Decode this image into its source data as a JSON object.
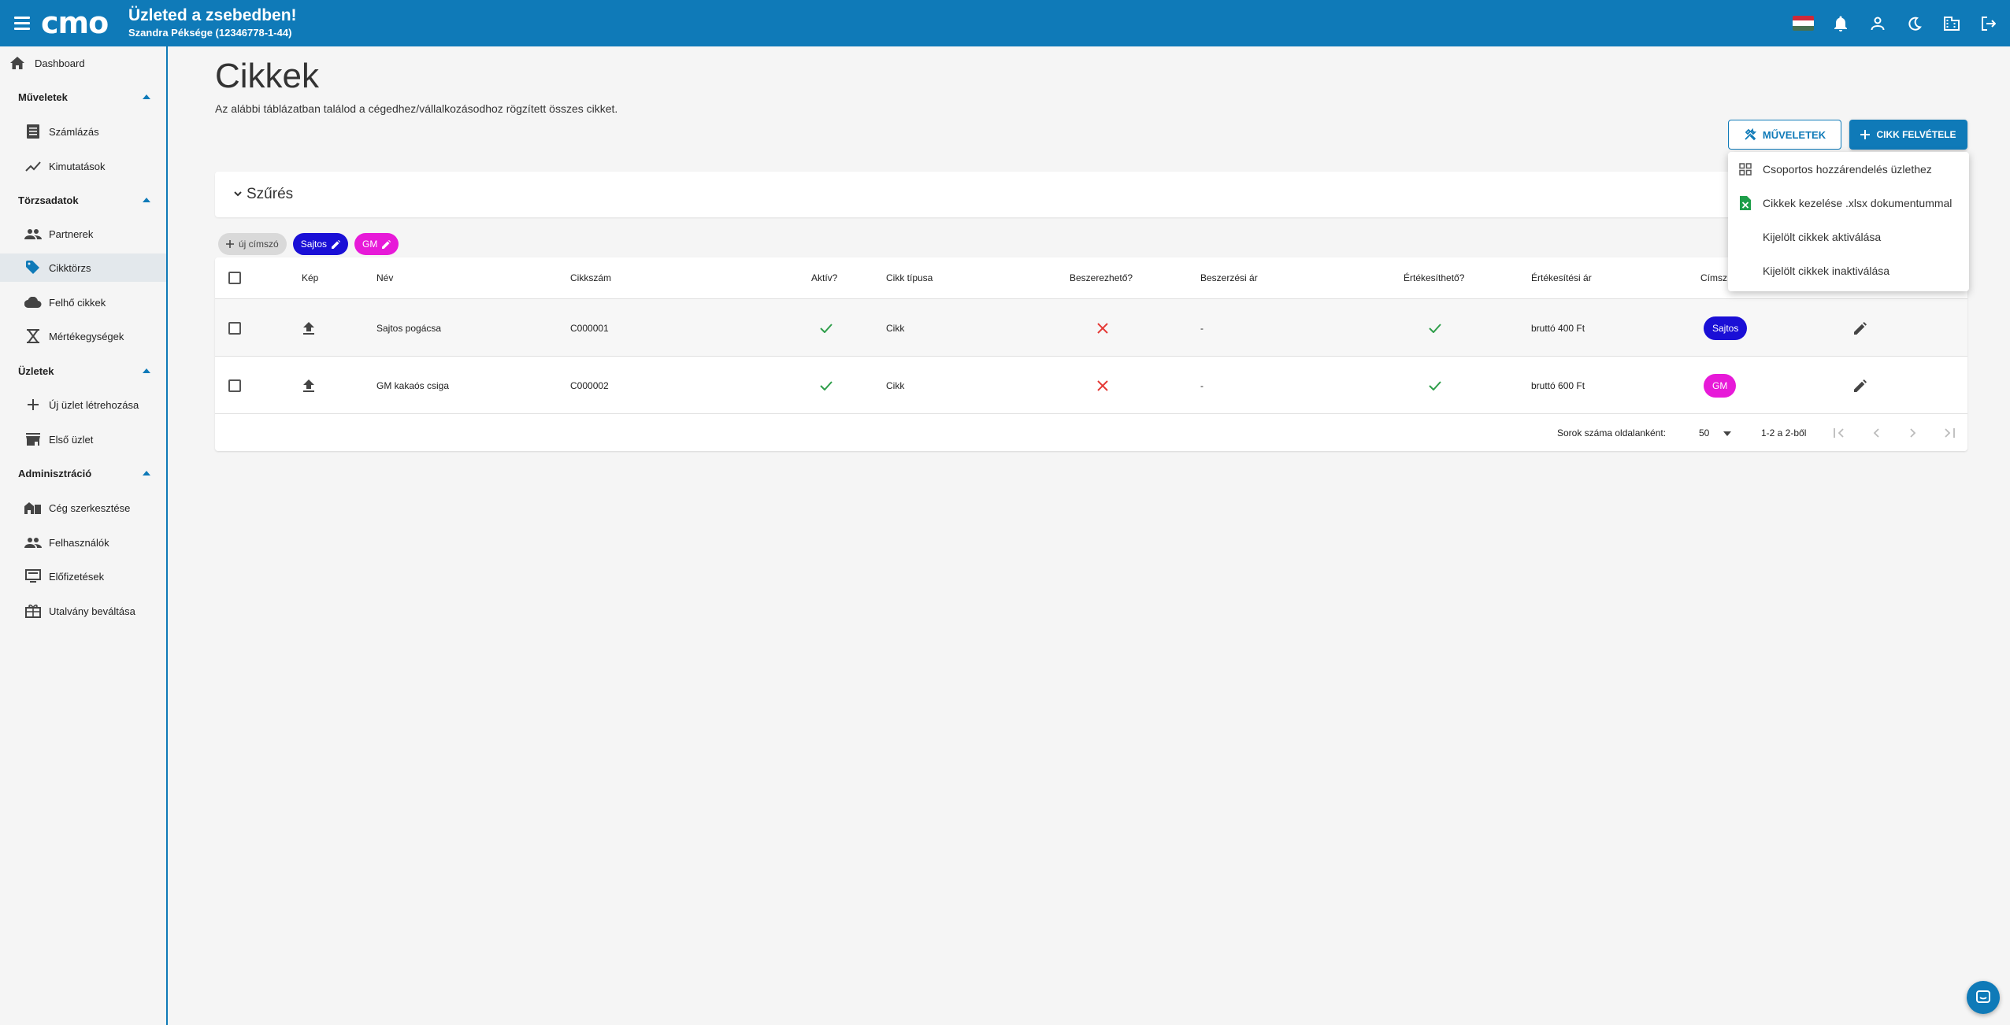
{
  "header": {
    "logo": "cmo",
    "title": "Üzleted a zsebedben!",
    "company": "Szandra Péksége (12346778-1-44)"
  },
  "sidebar": {
    "dashboard": "Dashboard",
    "sections": {
      "muveletek": "Műveletek",
      "torzsadatok": "Törzsadatok",
      "uzletek": "Üzletek",
      "adminisztracio": "Adminisztráció"
    },
    "items": {
      "szamlazas": "Számlázás",
      "kimutatasok": "Kimutatások",
      "partnerek": "Partnerek",
      "cikktorzs": "Cikktörzs",
      "felho_cikkek": "Felhő cikkek",
      "mertekegysegek": "Mértékegységek",
      "uj_uzlet": "Új üzlet létrehozása",
      "elso_uzlet": "Első üzlet",
      "ceg_szerkesztese": "Cég szerkesztése",
      "felhasznalok": "Felhasználók",
      "elofizetesek": "Előfizetések",
      "utalvany": "Utalvány beváltása"
    }
  },
  "main": {
    "title": "Cikkek",
    "description": "Az alábbi táblázatban találod a cégedhez/vállalkozásodhoz rögzített összes cikket.",
    "ops_button": "MŰVELETEK",
    "add_button": "CIKK FELVÉTELE",
    "filter_label": "Szűrés"
  },
  "chips": {
    "new": "új címszó",
    "tags": [
      {
        "label": "Sajtos",
        "color": "#1a0fd6"
      },
      {
        "label": "GM",
        "color": "#e71ad8"
      }
    ]
  },
  "table": {
    "headers": {
      "kep": "Kép",
      "nev": "Név",
      "cikkszam": "Cikkszám",
      "aktiv": "Aktív?",
      "tipus": "Cikk típusa",
      "beszerezheto": "Beszerezhető?",
      "beszerzesi_ar": "Beszerzési ár",
      "ertekesitheto": "Értékesíthető?",
      "ertekesitesi_ar": "Értékesítési ár",
      "cimszo": "Címsz"
    },
    "rows": [
      {
        "nev": "Sajtos pogácsa",
        "cikkszam": "C000001",
        "tipus": "Cikk",
        "beszerzesi_ar": "-",
        "ertekesitesi_ar": "bruttó 400 Ft",
        "tag": "Sajtos",
        "tag_color": "#1a0fd6"
      },
      {
        "nev": "GM kakaós csiga",
        "cikkszam": "C000002",
        "tipus": "Cikk",
        "beszerzesi_ar": "-",
        "ertekesitesi_ar": "bruttó 600 Ft",
        "tag": "GM",
        "tag_color": "#e71ad8"
      }
    ],
    "footer": {
      "rows_per_page_label": "Sorok száma oldalanként:",
      "rows_per_page": "50",
      "range": "1-2 a 2-ből"
    }
  },
  "dropdown": {
    "items": [
      "Csoportos hozzárendelés üzlethez",
      "Cikkek kezelése .xlsx dokumentummal",
      "Kijelölt cikkek aktiválása",
      "Kijelölt cikkek inaktiválása"
    ]
  },
  "colors": {
    "primary": "#0f7ab8",
    "check": "#2e9e4a",
    "cross": "#e53935"
  }
}
